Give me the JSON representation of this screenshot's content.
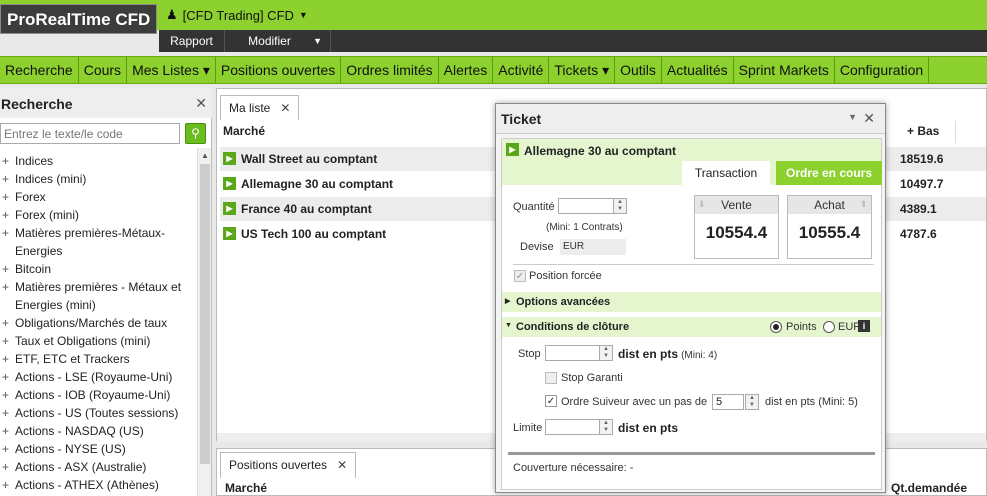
{
  "header": {
    "logo": "ProRealTime CFD",
    "account": "[CFD Trading] CFD",
    "rapport": "Rapport",
    "modifier": "Modifier"
  },
  "nav": [
    "Recherche",
    "Cours",
    "Mes Listes ▾",
    "Positions ouvertes",
    "Ordres limités",
    "Alertes",
    "Activité",
    "Tickets ▾",
    "Outils",
    "Actualités",
    "Sprint Markets",
    "Configuration"
  ],
  "left": {
    "title": "Recherche",
    "search_placeholder": "Entrez le texte/le code",
    "tree": [
      "Indices",
      "Indices (mini)",
      "Forex",
      "Forex (mini)",
      "Matières premières-Métaux-Energies",
      "Bitcoin",
      "Matières premières - Métaux et Energies (mini)",
      "Obligations/Marchés de taux",
      "Taux et Obligations (mini)",
      "ETF, ETC et Trackers",
      "Actions - LSE (Royaume-Uni)",
      "Actions - IOB (Royaume-Uni)",
      "Actions - US (Toutes sessions)",
      "Actions - NASDAQ (US)",
      "Actions - NYSE (US)",
      "Actions - ASX (Australie)",
      "Actions - ATHEX (Athènes)"
    ]
  },
  "liste": {
    "tab": "Ma liste",
    "col_marche": "Marché",
    "col_bas": "+ Bas",
    "rows": [
      {
        "name": "Wall Street au comptant",
        "bas": "18519.6"
      },
      {
        "name": "Allemagne 30 au comptant",
        "bas": "10497.7"
      },
      {
        "name": "France 40 au comptant",
        "bas": "4389.1"
      },
      {
        "name": "US Tech 100 au comptant",
        "bas": "4787.6"
      }
    ]
  },
  "positions": {
    "tab": "Positions ouvertes",
    "col_marche": "Marché",
    "col_qt": "Qt.demandée"
  },
  "ticket": {
    "title": "Ticket",
    "instrument": "Allemagne 30 au comptant",
    "tab_transaction": "Transaction",
    "tab_ordre": "Ordre en cours",
    "quantite_label": "Quantité",
    "mini": "(Mini: 1 Contrats)",
    "devise_label": "Devise",
    "devise_value": "EUR",
    "vente_label": "Vente",
    "vente_value": "10554.4",
    "achat_label": "Achat",
    "achat_value": "10555.4",
    "position_forcee": "Position forcée",
    "options_avancees": "Options avancées",
    "conditions": "Conditions de clôture",
    "radio_points": "Points",
    "radio_eur": "EUR",
    "stop_label": "Stop",
    "dist_pts": "dist en pts",
    "stop_mini": "(Mini: 4)",
    "stop_garanti": "Stop Garanti",
    "suiveur_label": "Ordre Suiveur avec un pas de",
    "suiveur_value": "5",
    "suiveur_suffix": "dist en pts (Mini: 5)",
    "limite_label": "Limite",
    "limite_dist": "dist en pts",
    "couverture": "Couverture nécessaire: -"
  }
}
